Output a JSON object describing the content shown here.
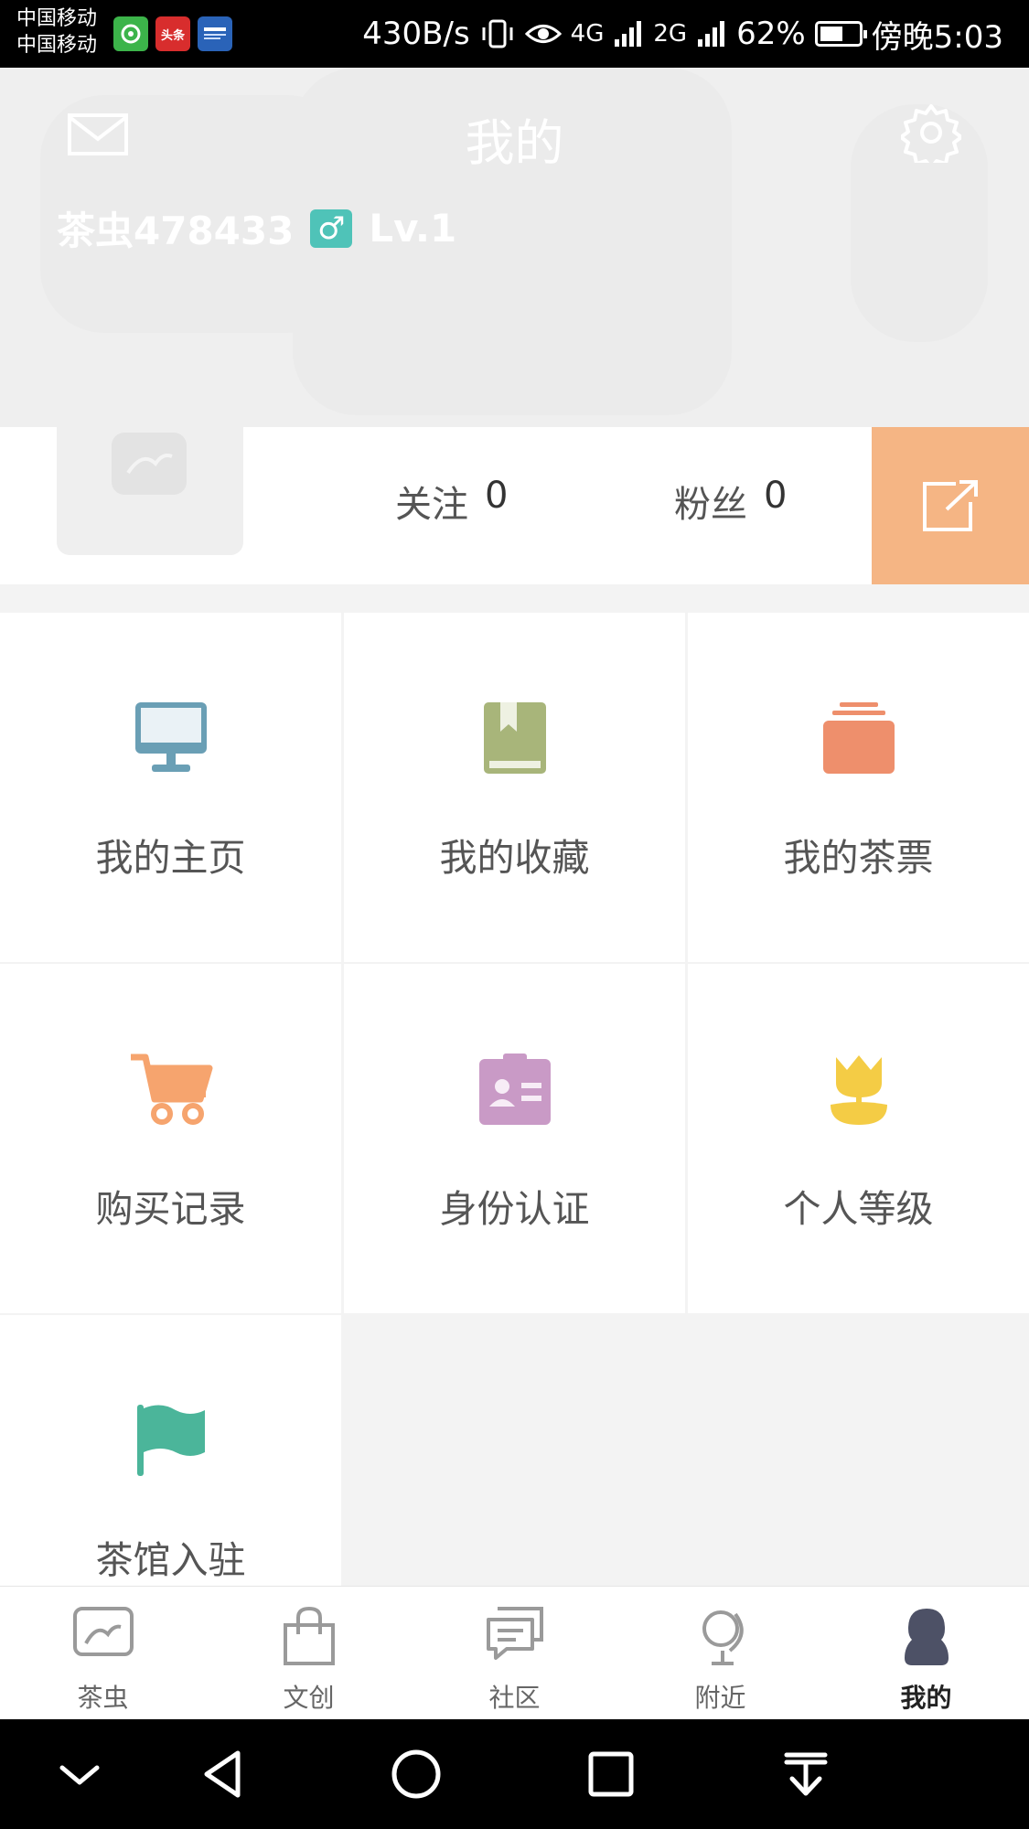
{
  "status_bar": {
    "carrier_1": "中国移动",
    "carrier_2": "中国移动",
    "app_icons": [
      "wechat-icon",
      "toutiao-icon",
      "news-icon"
    ],
    "toutiao_label": "头条",
    "network_speed": "430B/s",
    "signal_1": "4G",
    "signal_2": "2G",
    "battery": "62%",
    "time": "傍晚5:03"
  },
  "header": {
    "title": "我的",
    "username": "茶虫478433",
    "gender_symbol": "♂",
    "level": "Lv.1"
  },
  "stats": {
    "following_label": "关注",
    "following_count": "0",
    "fans_label": "粉丝",
    "fans_count": "0"
  },
  "menu": [
    {
      "label": "我的主页",
      "icon": "monitor-icon",
      "color": "#6a9fb5"
    },
    {
      "label": "我的收藏",
      "icon": "bookmark-book-icon",
      "color": "#a8b57a"
    },
    {
      "label": "我的茶票",
      "icon": "ticket-stack-icon",
      "color": "#ee8f6c"
    },
    {
      "label": "购买记录",
      "icon": "cart-icon",
      "color": "#f6a46e"
    },
    {
      "label": "身份认证",
      "icon": "id-card-icon",
      "color": "#c99ac6"
    },
    {
      "label": "个人等级",
      "icon": "tulip-icon",
      "color": "#f4cc45"
    },
    {
      "label": "茶馆入驻",
      "icon": "flag-icon",
      "color": "#4bb59a"
    }
  ],
  "tabs": [
    {
      "label": "茶虫",
      "icon": "tea-icon"
    },
    {
      "label": "文创",
      "icon": "shopping-bag-icon"
    },
    {
      "label": "社区",
      "icon": "chat-icon"
    },
    {
      "label": "附近",
      "icon": "globe-icon"
    },
    {
      "label": "我的",
      "icon": "person-icon",
      "active": true
    }
  ],
  "colors": {
    "share_button": "#f5b584",
    "gender_badge": "#4fc3b8",
    "active_tab": "#222222"
  }
}
